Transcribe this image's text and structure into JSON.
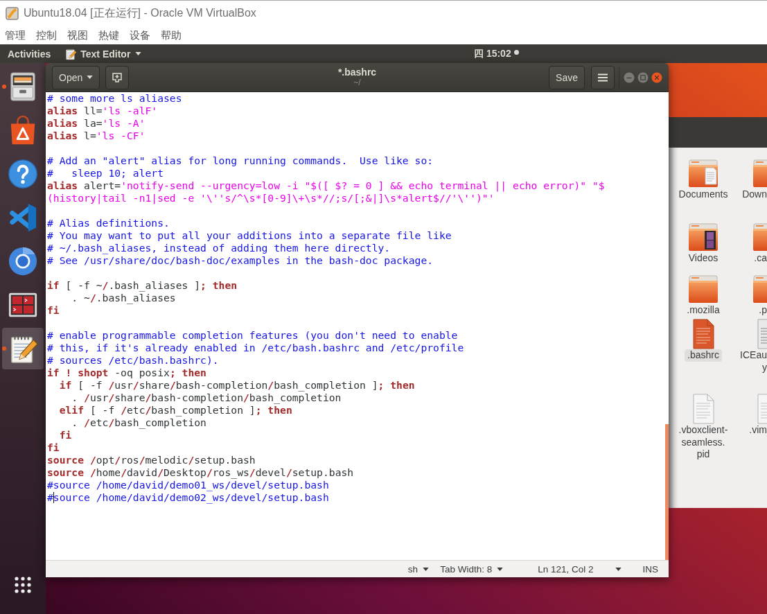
{
  "vbox_window": {
    "title": "Ubuntu18.04 [正在运行] - Oracle VM VirtualBox",
    "menu": [
      "管理",
      "控制",
      "视图",
      "热键",
      "设备",
      "帮助"
    ]
  },
  "top_panel": {
    "activities": "Activities",
    "app_menu": "Text Editor",
    "clock": "四 15:02"
  },
  "dock": {
    "items": [
      {
        "kind": "files",
        "running": true,
        "selected": false
      },
      {
        "kind": "software",
        "running": false,
        "selected": false
      },
      {
        "kind": "help",
        "running": false,
        "selected": false
      },
      {
        "kind": "code",
        "running": false,
        "selected": false
      },
      {
        "kind": "browser",
        "running": false,
        "selected": false
      },
      {
        "kind": "monitor",
        "running": false,
        "selected": false
      },
      {
        "kind": "notepad",
        "running": true,
        "selected": true
      }
    ]
  },
  "editor": {
    "open_button": "Open",
    "title": "*.bashrc",
    "subtitle": "~/",
    "save_button": "Save",
    "lines": [
      {
        "kind": "code",
        "tokens": [
          {
            "kind": "comment",
            "text": "# some more ls aliases"
          }
        ]
      },
      {
        "kind": "code",
        "tokens": [
          {
            "kind": "keyword",
            "text": "alias"
          },
          {
            "kind": "plain",
            "text": " ll="
          },
          {
            "kind": "string",
            "text": "'ls -alF'"
          }
        ]
      },
      {
        "kind": "code",
        "tokens": [
          {
            "kind": "keyword",
            "text": "alias"
          },
          {
            "kind": "plain",
            "text": " la="
          },
          {
            "kind": "string",
            "text": "'ls -A'"
          }
        ]
      },
      {
        "kind": "code",
        "tokens": [
          {
            "kind": "keyword",
            "text": "alias"
          },
          {
            "kind": "plain",
            "text": " l="
          },
          {
            "kind": "string",
            "text": "'ls -CF'"
          }
        ]
      },
      {
        "kind": "blank"
      },
      {
        "kind": "code",
        "tokens": [
          {
            "kind": "comment",
            "text": "# Add an \"alert\" alias for long running commands.  Use like so:"
          }
        ]
      },
      {
        "kind": "code",
        "tokens": [
          {
            "kind": "comment",
            "text": "#   sleep 10; alert"
          }
        ]
      },
      {
        "kind": "code",
        "tokens": [
          {
            "kind": "keyword",
            "text": "alias"
          },
          {
            "kind": "plain",
            "text": " alert="
          },
          {
            "kind": "string",
            "text": "'notify-send --urgency=low -i \"$([ $? = 0 ] && echo terminal || echo error)\" \"$"
          }
        ]
      },
      {
        "kind": "code",
        "tokens": [
          {
            "kind": "string",
            "text": "(history|tail -n1|sed -e '\\''s/^\\s*[0-9]\\+\\s*//;s/[;&|]\\s*alert$//'\\'')\"'"
          }
        ]
      },
      {
        "kind": "blank"
      },
      {
        "kind": "code",
        "tokens": [
          {
            "kind": "comment",
            "text": "# Alias definitions."
          }
        ]
      },
      {
        "kind": "code",
        "tokens": [
          {
            "kind": "comment",
            "text": "# You may want to put all your additions into a separate file like"
          }
        ]
      },
      {
        "kind": "code",
        "tokens": [
          {
            "kind": "comment",
            "text": "# ~/.bash_aliases, instead of adding them here directly."
          }
        ]
      },
      {
        "kind": "code",
        "tokens": [
          {
            "kind": "comment",
            "text": "# See /usr/share/doc/bash-doc/examples in the bash-doc package."
          }
        ]
      },
      {
        "kind": "blank"
      },
      {
        "kind": "code",
        "tokens": [
          {
            "kind": "keyword",
            "text": "if"
          },
          {
            "kind": "plain",
            "text": " [ -f ~"
          },
          {
            "kind": "keyword",
            "text": "/"
          },
          {
            "kind": "plain",
            "text": ".bash_aliases ]"
          },
          {
            "kind": "keyword",
            "text": "; then"
          }
        ]
      },
      {
        "kind": "code",
        "tokens": [
          {
            "kind": "plain",
            "text": "    . ~"
          },
          {
            "kind": "keyword",
            "text": "/"
          },
          {
            "kind": "plain",
            "text": ".bash_aliases"
          }
        ]
      },
      {
        "kind": "code",
        "tokens": [
          {
            "kind": "keyword",
            "text": "fi"
          }
        ]
      },
      {
        "kind": "blank"
      },
      {
        "kind": "code",
        "tokens": [
          {
            "kind": "comment",
            "text": "# enable programmable completion features (you don't need to enable"
          }
        ]
      },
      {
        "kind": "code",
        "tokens": [
          {
            "kind": "comment",
            "text": "# this, if it's already enabled in /etc/bash.bashrc and /etc/profile"
          }
        ]
      },
      {
        "kind": "code",
        "tokens": [
          {
            "kind": "comment",
            "text": "# sources /etc/bash.bashrc)."
          }
        ]
      },
      {
        "kind": "code",
        "tokens": [
          {
            "kind": "keyword",
            "text": "if ! shopt"
          },
          {
            "kind": "plain",
            "text": " -oq posix"
          },
          {
            "kind": "keyword",
            "text": "; then"
          }
        ]
      },
      {
        "kind": "code",
        "tokens": [
          {
            "kind": "keyword",
            "text": "  if"
          },
          {
            "kind": "plain",
            "text": " [ -f "
          },
          {
            "kind": "keyword",
            "text": "/"
          },
          {
            "kind": "plain",
            "text": "usr"
          },
          {
            "kind": "keyword",
            "text": "/"
          },
          {
            "kind": "plain",
            "text": "share"
          },
          {
            "kind": "keyword",
            "text": "/"
          },
          {
            "kind": "plain",
            "text": "bash-completion"
          },
          {
            "kind": "keyword",
            "text": "/"
          },
          {
            "kind": "plain",
            "text": "bash_completion ]"
          },
          {
            "kind": "keyword",
            "text": "; then"
          }
        ]
      },
      {
        "kind": "code",
        "tokens": [
          {
            "kind": "plain",
            "text": "    . "
          },
          {
            "kind": "keyword",
            "text": "/"
          },
          {
            "kind": "plain",
            "text": "usr"
          },
          {
            "kind": "keyword",
            "text": "/"
          },
          {
            "kind": "plain",
            "text": "share"
          },
          {
            "kind": "keyword",
            "text": "/"
          },
          {
            "kind": "plain",
            "text": "bash-completion"
          },
          {
            "kind": "keyword",
            "text": "/"
          },
          {
            "kind": "plain",
            "text": "bash_completion"
          }
        ]
      },
      {
        "kind": "code",
        "tokens": [
          {
            "kind": "keyword",
            "text": "  elif"
          },
          {
            "kind": "plain",
            "text": " [ -f "
          },
          {
            "kind": "keyword",
            "text": "/"
          },
          {
            "kind": "plain",
            "text": "etc"
          },
          {
            "kind": "keyword",
            "text": "/"
          },
          {
            "kind": "plain",
            "text": "bash_completion ]"
          },
          {
            "kind": "keyword",
            "text": "; then"
          }
        ]
      },
      {
        "kind": "code",
        "tokens": [
          {
            "kind": "plain",
            "text": "    . "
          },
          {
            "kind": "keyword",
            "text": "/"
          },
          {
            "kind": "plain",
            "text": "etc"
          },
          {
            "kind": "keyword",
            "text": "/"
          },
          {
            "kind": "plain",
            "text": "bash_completion"
          }
        ]
      },
      {
        "kind": "code",
        "tokens": [
          {
            "kind": "keyword",
            "text": "  fi"
          }
        ]
      },
      {
        "kind": "code",
        "tokens": [
          {
            "kind": "keyword",
            "text": "fi"
          }
        ]
      },
      {
        "kind": "code",
        "tokens": [
          {
            "kind": "keyword",
            "text": "source /"
          },
          {
            "kind": "plain",
            "text": "opt"
          },
          {
            "kind": "keyword",
            "text": "/"
          },
          {
            "kind": "plain",
            "text": "ros"
          },
          {
            "kind": "keyword",
            "text": "/"
          },
          {
            "kind": "plain",
            "text": "melodic"
          },
          {
            "kind": "keyword",
            "text": "/"
          },
          {
            "kind": "plain",
            "text": "setup.bash"
          }
        ]
      },
      {
        "kind": "code",
        "tokens": [
          {
            "kind": "keyword",
            "text": "source /"
          },
          {
            "kind": "plain",
            "text": "home"
          },
          {
            "kind": "keyword",
            "text": "/"
          },
          {
            "kind": "plain",
            "text": "david"
          },
          {
            "kind": "keyword",
            "text": "/"
          },
          {
            "kind": "plain",
            "text": "Desktop"
          },
          {
            "kind": "keyword",
            "text": "/"
          },
          {
            "kind": "plain",
            "text": "ros_ws"
          },
          {
            "kind": "keyword",
            "text": "/"
          },
          {
            "kind": "plain",
            "text": "devel"
          },
          {
            "kind": "keyword",
            "text": "/"
          },
          {
            "kind": "plain",
            "text": "setup.bash"
          }
        ]
      },
      {
        "kind": "code",
        "tokens": [
          {
            "kind": "comment",
            "text": "#source /home/david/demo01_ws/devel/setup.bash"
          }
        ]
      },
      {
        "kind": "code",
        "tokens": [
          {
            "kind": "comment",
            "text": "#"
          },
          {
            "kind": "caret"
          },
          {
            "kind": "comment",
            "text": "source /home/david/demo02_ws/devel/setup.bash"
          }
        ]
      }
    ],
    "status_bar": {
      "language": "sh",
      "tab_width": "Tab Width: 8",
      "position": "Ln 121, Col 2",
      "mode": "INS"
    }
  },
  "desktop_files": {
    "items": [
      {
        "kind": "documents-folder",
        "label": [
          "Documents"
        ],
        "selected": false
      },
      {
        "kind": "folder",
        "label": [
          "Down"
        ],
        "selected": false
      },
      {
        "kind": "videos-folder",
        "label": [
          "Videos"
        ],
        "selected": false
      },
      {
        "kind": "folder",
        "label": [
          ".ca"
        ],
        "selected": false
      },
      {
        "kind": "folder",
        "label": [
          ".mozilla"
        ],
        "selected": false
      },
      {
        "kind": "folder",
        "label": [
          ".p"
        ],
        "selected": false
      },
      {
        "kind": "script",
        "label": [
          ".bashrc"
        ],
        "selected": true
      },
      {
        "kind": "binary",
        "label": [
          "ICEau",
          "y"
        ],
        "selected": false
      },
      {
        "kind": "text",
        "label": [
          ".vboxclient-",
          "seamless.",
          "pid"
        ],
        "selected": false
      },
      {
        "kind": "text",
        "label": [
          ".vim"
        ],
        "selected": false
      }
    ]
  }
}
